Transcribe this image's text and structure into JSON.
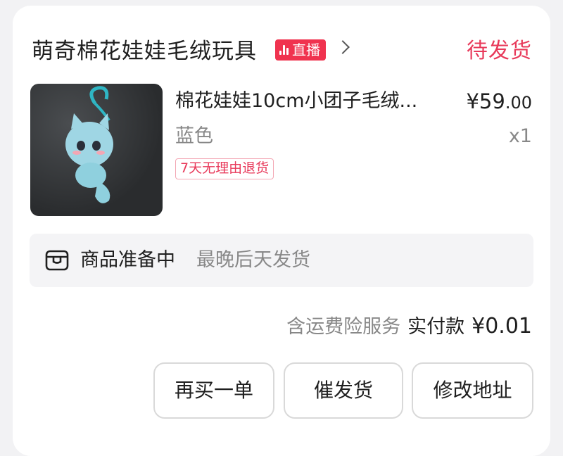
{
  "shop": {
    "name": "萌奇棉花娃娃毛绒玩具",
    "live_label": "直播"
  },
  "order": {
    "status": "待发货"
  },
  "product": {
    "title": "棉花娃娃10cm小团子毛绒...",
    "price_symbol": "¥",
    "price_main": "59",
    "price_cents": ".00",
    "variant": "蓝色",
    "quantity": "x1",
    "return_policy": "7天无理由退货"
  },
  "shipping": {
    "status": "商品准备中",
    "eta": "最晚后天发货"
  },
  "payment": {
    "insurance": "含运费险服务",
    "paid_label": "实付款",
    "paid_amount": "¥0.01"
  },
  "actions": {
    "rebuy": "再买一单",
    "urge": "催发货",
    "modify_address": "修改地址"
  },
  "colors": {
    "accent": "#e8395a",
    "live_badge": "#f0334f"
  }
}
